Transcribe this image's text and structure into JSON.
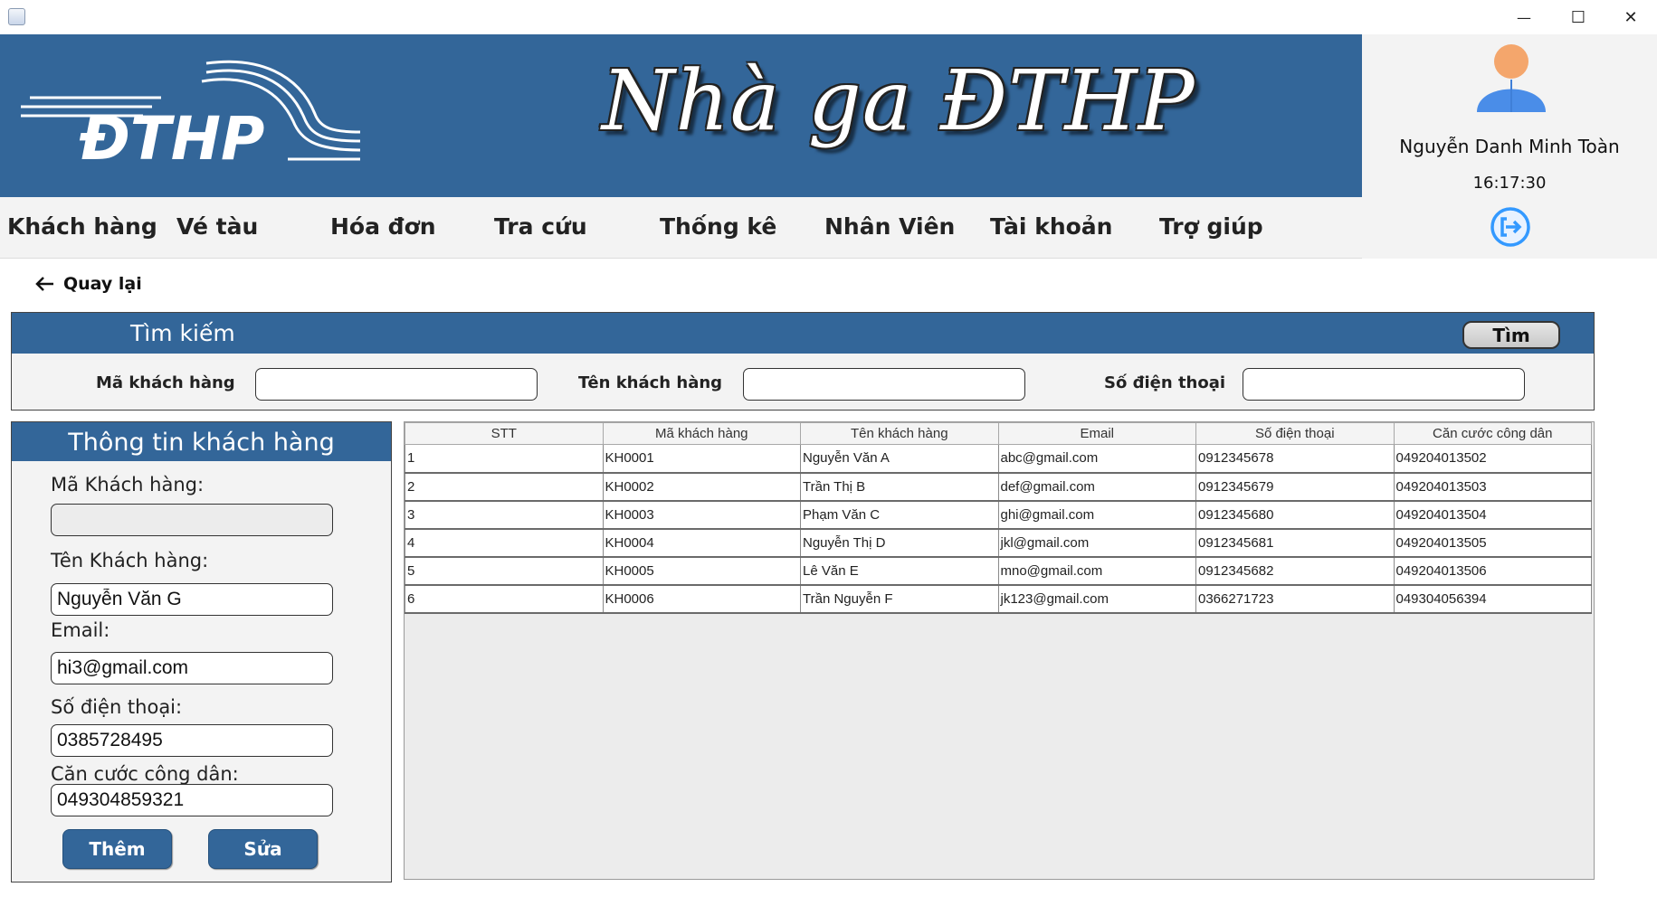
{
  "window": {
    "min_glyph": "—",
    "max_glyph": "☐",
    "close_glyph": "✕"
  },
  "header": {
    "logo_text": "ĐTHP",
    "banner_title": "Nhà ga ĐTHP"
  },
  "user": {
    "name": "Nguyễn Danh Minh Toàn",
    "time": "16:17:30"
  },
  "menu": [
    {
      "label": "Khách hàng"
    },
    {
      "label": "Vé tàu"
    },
    {
      "label": "Hóa đơn"
    },
    {
      "label": "Tra cứu"
    },
    {
      "label": "Thống kê"
    },
    {
      "label": "Nhân Viên"
    },
    {
      "label": "Tài khoản"
    },
    {
      "label": "Trợ giúp"
    }
  ],
  "back": {
    "label": "Quay lại"
  },
  "search": {
    "title": "Tìm kiếm",
    "button": "Tìm",
    "fields": [
      {
        "label": "Mã khách hàng",
        "value": ""
      },
      {
        "label": "Tên khách hàng",
        "value": ""
      },
      {
        "label": "Số điện thoại",
        "value": ""
      }
    ]
  },
  "info": {
    "title": "Thông tin khách hàng",
    "fields": [
      {
        "label": "Mã Khách hàng:",
        "value": ""
      },
      {
        "label": "Tên Khách hàng:",
        "value": "Nguyễn Văn G"
      },
      {
        "label": "Email:",
        "value": "hi3@gmail.com"
      },
      {
        "label": "Số điện thoại:",
        "value": "0385728495"
      },
      {
        "label": "Căn cước công dân:",
        "value": "049304859321"
      }
    ],
    "add_button": "Thêm",
    "edit_button": "Sửa"
  },
  "table": {
    "columns": [
      "STT",
      "Mã khách hàng",
      "Tên khách hàng",
      "Email",
      "Số điện thoại",
      "Căn cước công dân"
    ],
    "rows": [
      [
        "1",
        "KH0001",
        "Nguyễn Văn A",
        "abc@gmail.com",
        "0912345678",
        "049204013502"
      ],
      [
        "2",
        "KH0002",
        "Trần Thị B",
        "def@gmail.com",
        "0912345679",
        "049204013503"
      ],
      [
        "3",
        "KH0003",
        "Phạm Văn C",
        "ghi@gmail.com",
        "0912345680",
        "049204013504"
      ],
      [
        "4",
        "KH0004",
        "Nguyễn Thị D",
        "jkl@gmail.com",
        "0912345681",
        "049204013505"
      ],
      [
        "5",
        "KH0005",
        "Lê Văn E",
        "mno@gmail.com",
        "0912345682",
        "049204013506"
      ],
      [
        "6",
        "KH0006",
        "Trần Nguyễn F",
        "jk123@gmail.com",
        "0366271723",
        "049304056394"
      ]
    ]
  },
  "colors": {
    "primary": "#336699",
    "panel_bg": "#f3f3f3",
    "logout_accent": "#3399ff"
  },
  "icons": {
    "avatar": "user-avatar-icon",
    "logout": "logout-icon",
    "back": "arrow-left-icon"
  }
}
